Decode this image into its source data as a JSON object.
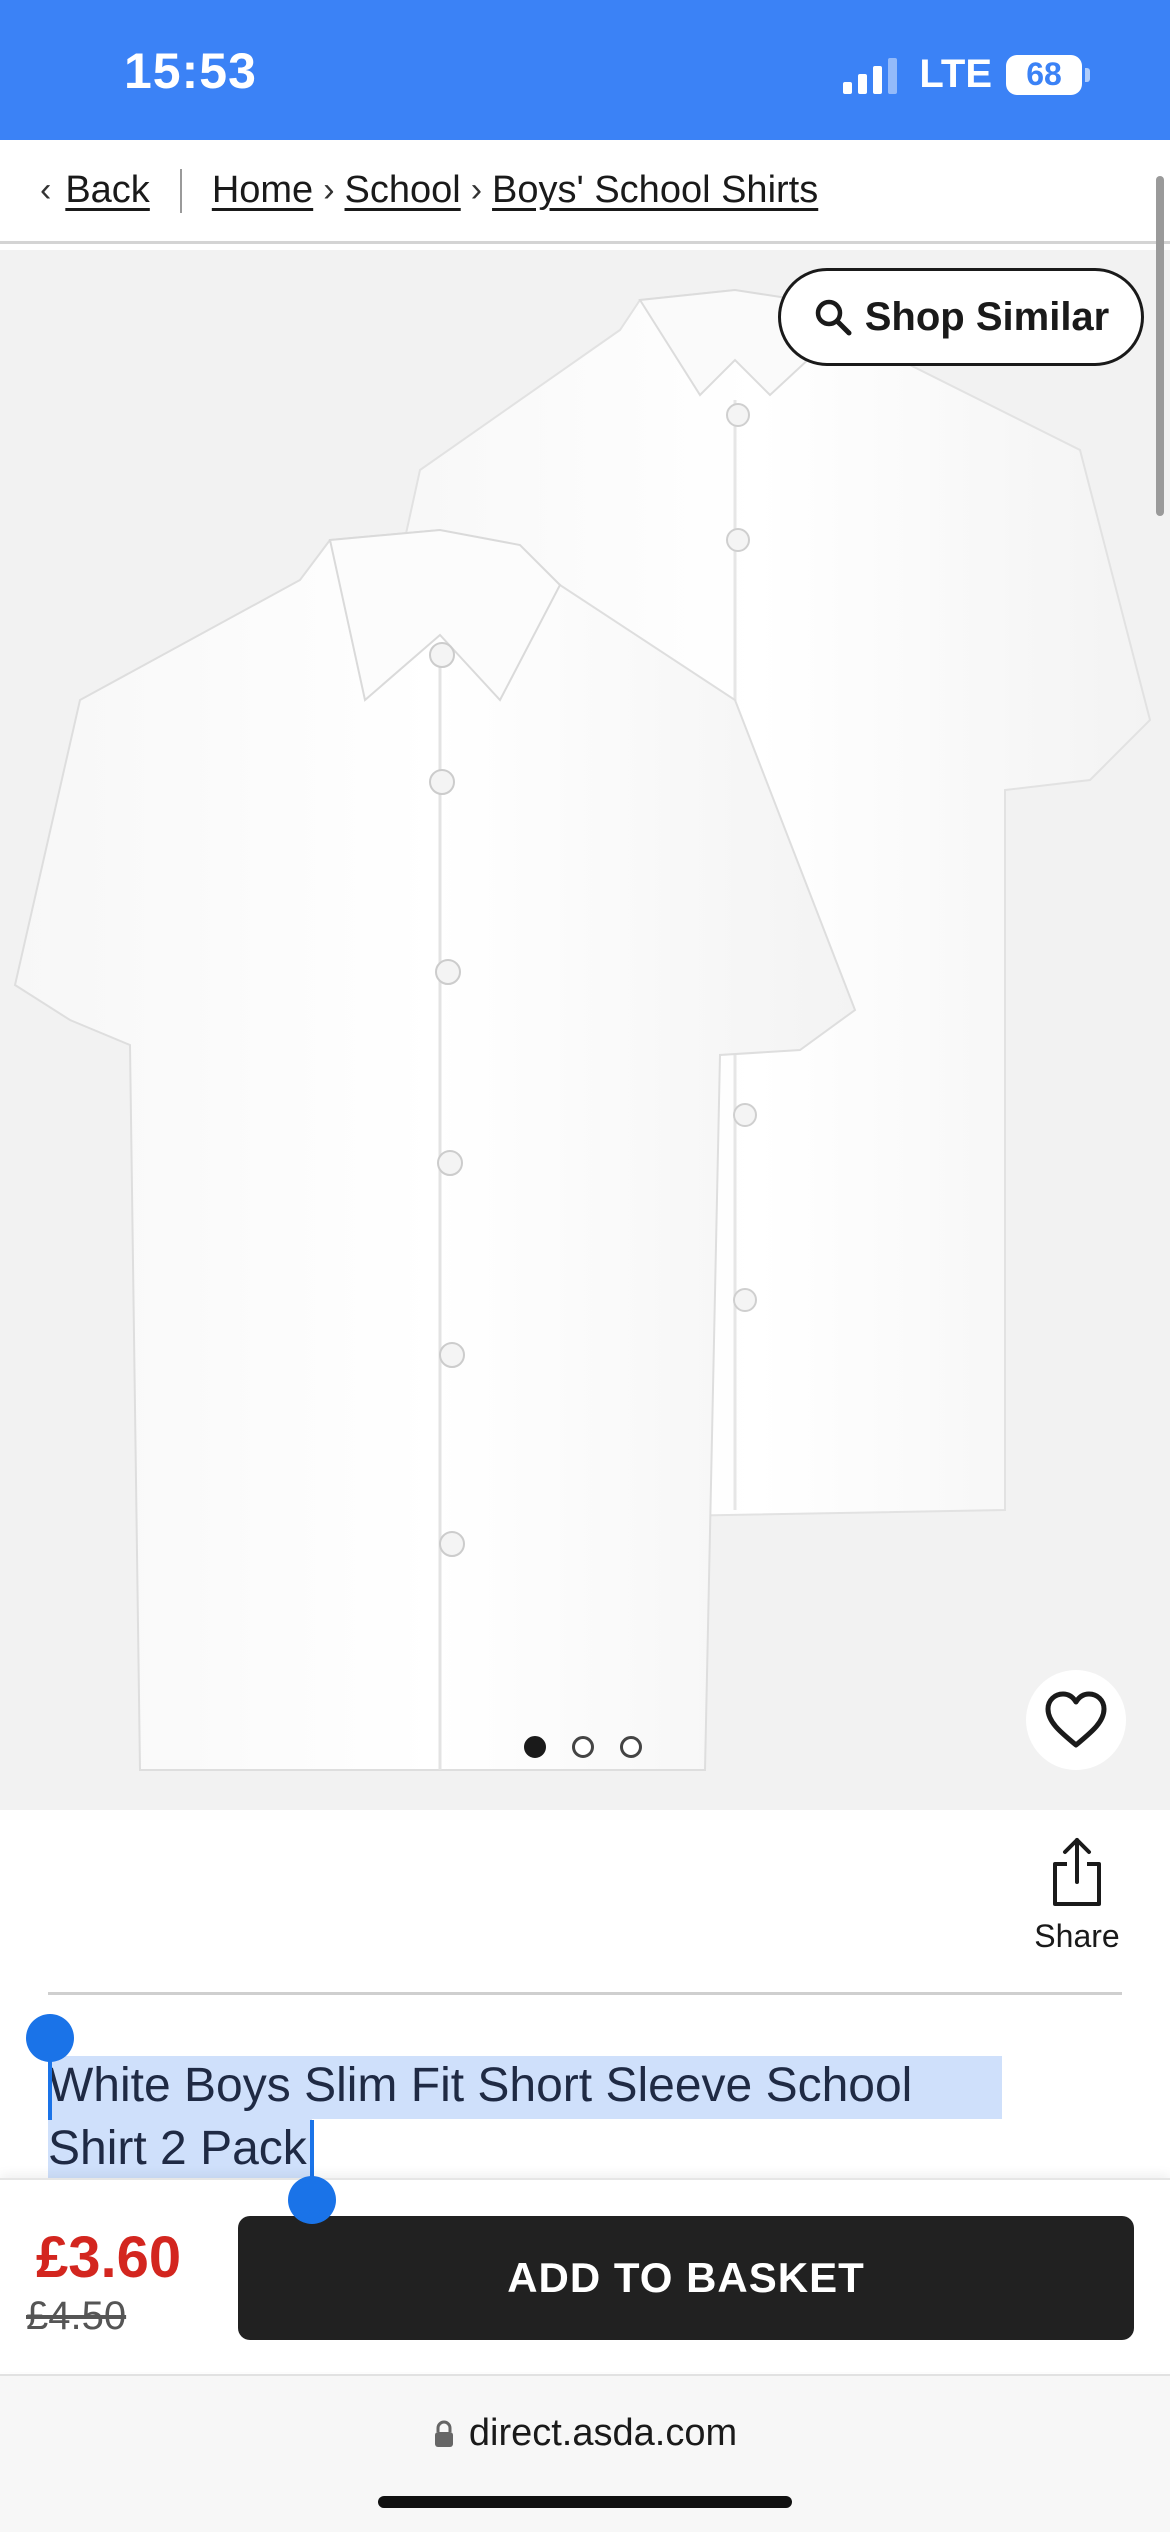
{
  "status_bar": {
    "time": "15:53",
    "network": "LTE",
    "battery": "68",
    "signal_icon": "signal-bars-icon"
  },
  "breadcrumb": {
    "back_label": "Back",
    "items": [
      "Home",
      "School",
      "Boys' School Shirts"
    ]
  },
  "product": {
    "shop_similar_label": "Shop Similar",
    "image_count": 3,
    "active_image_index": 0,
    "share_label": "Share",
    "title_line1": "White Boys Slim Fit Short Sleeve School",
    "title_line2": "Shirt 2 Pack"
  },
  "pricing": {
    "current_price": "£3.60",
    "was_price": "£4.50",
    "add_to_basket_label": "ADD TO BASKET"
  },
  "browser": {
    "url": "direct.asda.com"
  },
  "colors": {
    "status_bar": "#3b82f6",
    "price": "#d3261f",
    "button": "#212121",
    "selection": "#cfe0fb",
    "selection_handle": "#1a73e8"
  }
}
